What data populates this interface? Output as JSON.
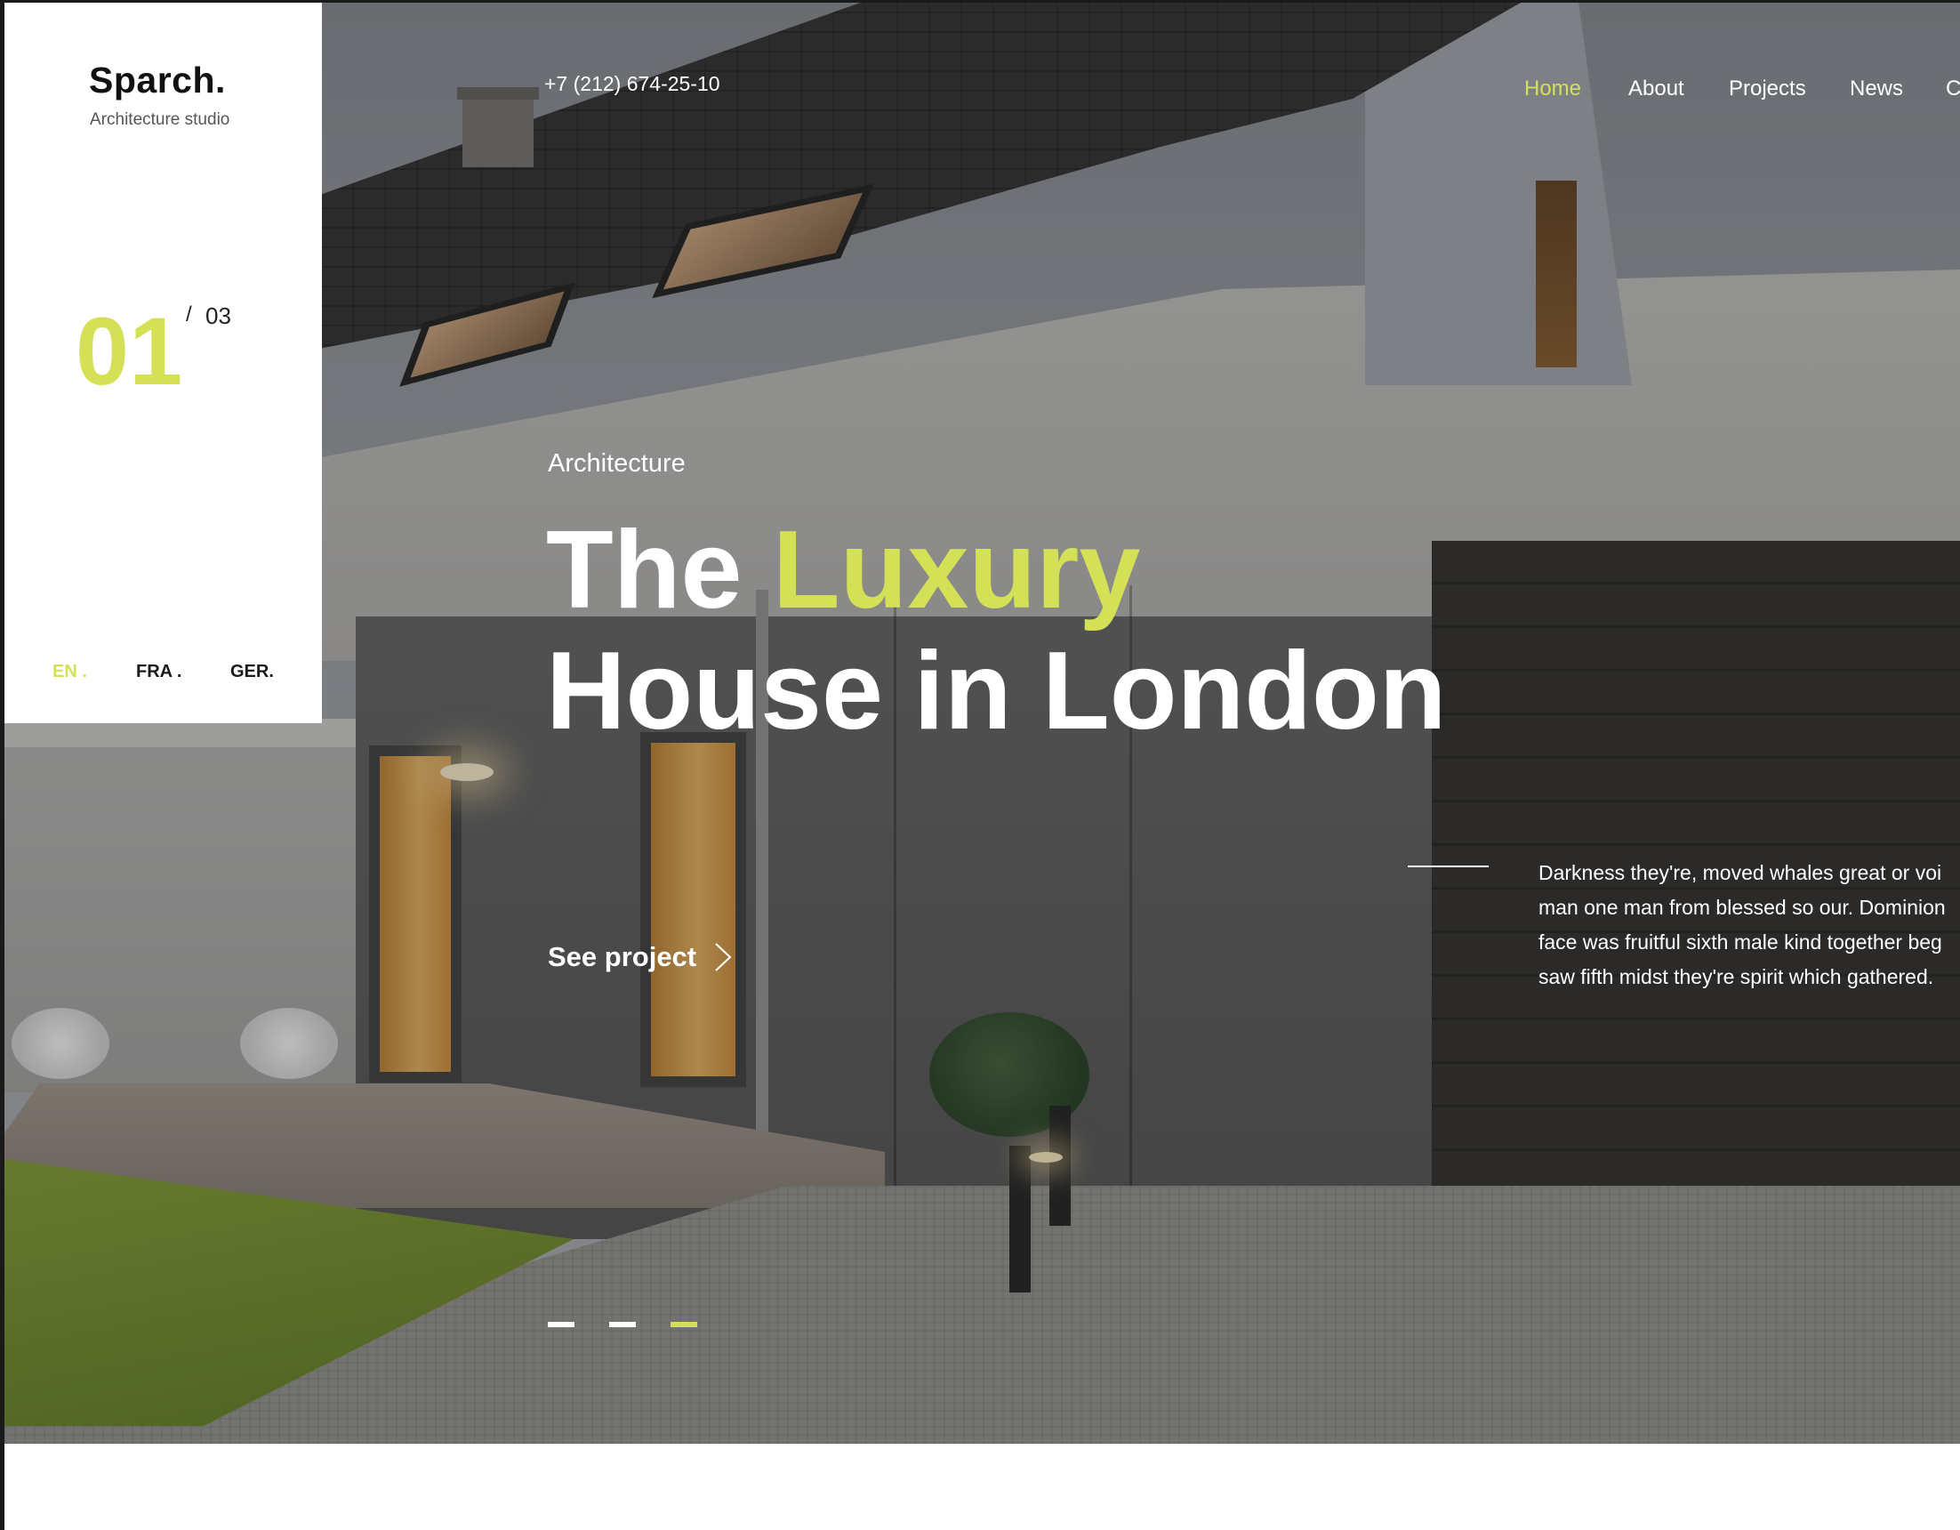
{
  "brand": {
    "name": "Sparch.",
    "tagline": "Architecture studio",
    "accent_color": "#d4e157"
  },
  "slider": {
    "current": "01",
    "separator": "/",
    "total": "03",
    "indicators": [
      {
        "active": false
      },
      {
        "active": false
      },
      {
        "active": true
      }
    ]
  },
  "languages": [
    {
      "label": "EN .",
      "active": true
    },
    {
      "label": "FRA .",
      "active": false
    },
    {
      "label": "GER.",
      "active": false
    }
  ],
  "header": {
    "phone": "+7 (212) 674-25-10",
    "nav": [
      {
        "label": "Home",
        "active": true
      },
      {
        "label": "About",
        "active": false
      },
      {
        "label": "Projects",
        "active": false
      },
      {
        "label": "News",
        "active": false
      },
      {
        "label": "C",
        "active": false
      }
    ]
  },
  "hero": {
    "eyebrow": "Architecture",
    "headline": {
      "line1_plain": "The ",
      "line1_accent": "Luxury",
      "line2": "House in London"
    },
    "cta_label": "See project",
    "cta_icon": "chevron-right-icon",
    "description_lines": [
      "Darkness they're, moved whales great or voi",
      "man one man from blessed so our. Dominion",
      "face was fruitful sixth male kind together beg",
      "saw fifth midst they're spirit which gathered."
    ]
  }
}
